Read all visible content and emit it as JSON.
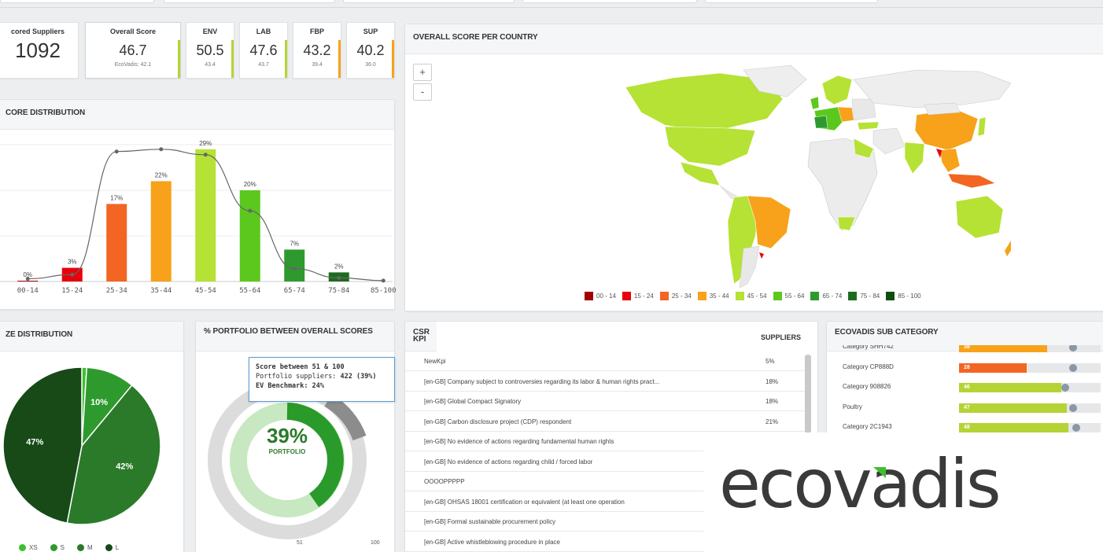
{
  "kpis": {
    "scored": {
      "label": "cored Suppliers",
      "value": "1092"
    },
    "overall": {
      "label": "Overall Score",
      "value": "46.7",
      "sub": "EcoVadis: 42.1",
      "color": "#b5d334"
    },
    "env": {
      "label": "ENV",
      "value": "50.5",
      "sub": "43.4",
      "color": "#b5d334"
    },
    "lab": {
      "label": "LAB",
      "value": "47.6",
      "sub": "43.7",
      "color": "#b5d334"
    },
    "fbp": {
      "label": "FBP",
      "value": "43.2",
      "sub": "39.4",
      "color": "#f7a21a"
    },
    "sup": {
      "label": "SUP",
      "value": "40.2",
      "sub": "36.0",
      "color": "#f7a21a"
    }
  },
  "score_distribution": {
    "title": "CORE DISTRIBUTION",
    "chart_data": {
      "type": "bar",
      "categories": [
        "00-14",
        "15-24",
        "25-34",
        "35-44",
        "45-54",
        "55-64",
        "65-74",
        "75-84",
        "85-100"
      ],
      "values": [
        0,
        3,
        17,
        22,
        29,
        20,
        7,
        2,
        null
      ],
      "value_labels": [
        "0%",
        "3%",
        "17%",
        "22%",
        "29%",
        "20%",
        "7%",
        "2%",
        ""
      ],
      "colors": [
        "#a30000",
        "#e8000b",
        "#f26522",
        "#f7a21a",
        "#b5e234",
        "#5cc81e",
        "#2e9a2e",
        "#1e6b1e",
        "#0f4d0f"
      ],
      "curve": [
        0.6,
        1.5,
        28.5,
        29,
        27.8,
        15.5,
        2.8,
        0.8,
        0.2
      ],
      "ylim": [
        0,
        30
      ]
    }
  },
  "map": {
    "title": "OVERALL SCORE PER COUNTRY",
    "zoom_in": "+",
    "zoom_out": "-",
    "legend": [
      {
        "label": "00 - 14",
        "color": "#a30000"
      },
      {
        "label": "15 - 24",
        "color": "#e8000b"
      },
      {
        "label": "25 - 34",
        "color": "#f26522"
      },
      {
        "label": "35 - 44",
        "color": "#f7a21a"
      },
      {
        "label": "45 - 54",
        "color": "#b5e234"
      },
      {
        "label": "55 - 64",
        "color": "#5cc81e"
      },
      {
        "label": "65 - 74",
        "color": "#2e9a2e"
      },
      {
        "label": "75 - 84",
        "color": "#1e6b1e"
      },
      {
        "label": "85 - 100",
        "color": "#0f4d0f"
      }
    ]
  },
  "size_distribution": {
    "title": "ZE DISTRIBUTION",
    "chart_data": {
      "type": "pie",
      "categories": [
        "XS",
        "S",
        "M",
        "L"
      ],
      "values": [
        1,
        10,
        42,
        47
      ],
      "labels": [
        "",
        "10%",
        "42%",
        "47%"
      ],
      "colors": [
        "#3fbf2f",
        "#2e9a2e",
        "#2a7a2a",
        "#174a17"
      ]
    }
  },
  "portfolio": {
    "title": "% PORTFOLIO BETWEEN OVERALL SCORES",
    "center_value": "39%",
    "center_label": "PORTFOLIO",
    "tooltip_line1": "Score between 51 & 100",
    "tooltip_line2_label": "Portfolio suppliers:",
    "tooltip_line2_value": "422 (39%)",
    "tooltip_line3": "EV Benchmark: 24%",
    "axis_min": "51",
    "axis_max": "100"
  },
  "csr": {
    "title": "CSR KPI",
    "col_suppliers": "SUPPLIERS",
    "rows": [
      {
        "name": "NewKpi",
        "pct": "5%"
      },
      {
        "name": "[en-GB] Company subject to controversies regarding its labor & human rights pract...",
        "pct": "18%"
      },
      {
        "name": "[en-GB] Global Compact Signatory",
        "pct": "18%"
      },
      {
        "name": "[en-GB] Carbon disclosure project (CDP) respondent",
        "pct": "21%"
      },
      {
        "name": "[en-GB] No evidence of actions regarding fundamental human rights",
        "pct": ""
      },
      {
        "name": "[en-GB] No evidence of actions regarding child / forced labor",
        "pct": ""
      },
      {
        "name": "OOOOPPPPP",
        "pct": ""
      },
      {
        "name": "[en-GB] OHSAS 18001 certification or equivalent (at least one operation",
        "pct": ""
      },
      {
        "name": "[en-GB] Formal sustainable procurement policy",
        "pct": ""
      },
      {
        "name": "[en-GB] Active whistleblowing procedure in place",
        "pct": ""
      }
    ]
  },
  "subcategory": {
    "title": "ECOVADIS SUB CATEGORY",
    "rows": [
      {
        "name": "Category SHH742",
        "score": "38",
        "fill": 0.62,
        "bench": 0.78,
        "color": "#f7a21a"
      },
      {
        "name": "Category CP888D",
        "score": "28",
        "fill": 0.48,
        "bench": 0.78,
        "color": "#f26522"
      },
      {
        "name": "Category 908826",
        "score": "46",
        "fill": 0.72,
        "bench": 0.72,
        "color": "#b5d334"
      },
      {
        "name": "Poultry",
        "score": "47",
        "fill": 0.76,
        "bench": 0.78,
        "color": "#b5d334"
      },
      {
        "name": "Category 2C1943",
        "score": "48",
        "fill": 0.77,
        "bench": 0.8,
        "color": "#b5d334"
      }
    ]
  },
  "brand": {
    "logo_text": "ecovadis"
  }
}
